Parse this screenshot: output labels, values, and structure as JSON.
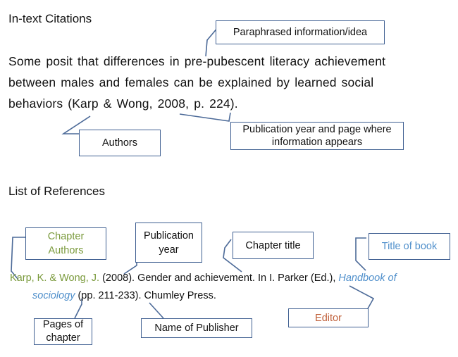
{
  "intext": {
    "heading": "In-text Citations",
    "lines": [
      "Some posit that differences in pre-pubescent literacy achievement",
      "between males and females can be explained by learned social",
      "behaviors (Karp & Wong, 2008, p. 224)."
    ],
    "callouts": {
      "paraphrased": "Paraphrased information/idea",
      "authors": "Authors",
      "pubyear_line1": "Publication year and page where",
      "pubyear_line2": "information appears"
    }
  },
  "references": {
    "heading": "List of References",
    "entry": {
      "authors": "Karp, K. & Wong, J.",
      "year": " (2008).  Gender and achievement. In I. Parker (Ed.), ",
      "book_title_1": "Handbook of",
      "book_title_2": "sociology",
      "rest": " (pp. 211-233).  Chumley Press."
    },
    "callouts": {
      "chapter_authors_1": "Chapter",
      "chapter_authors_2": "Authors",
      "pub_year_1": "Publication",
      "pub_year_2": "year",
      "chapter_title": "Chapter title",
      "title_of_book": "Title of book",
      "pages_1": "Pages of",
      "pages_2": "chapter",
      "publisher": "Name of Publisher",
      "editor": "Editor"
    }
  },
  "colors": {
    "box_border": "#3f5f91",
    "authors_green": "#7a9a3c",
    "book_blue": "#4f8fcb",
    "editor_orange": "#c0603a"
  }
}
